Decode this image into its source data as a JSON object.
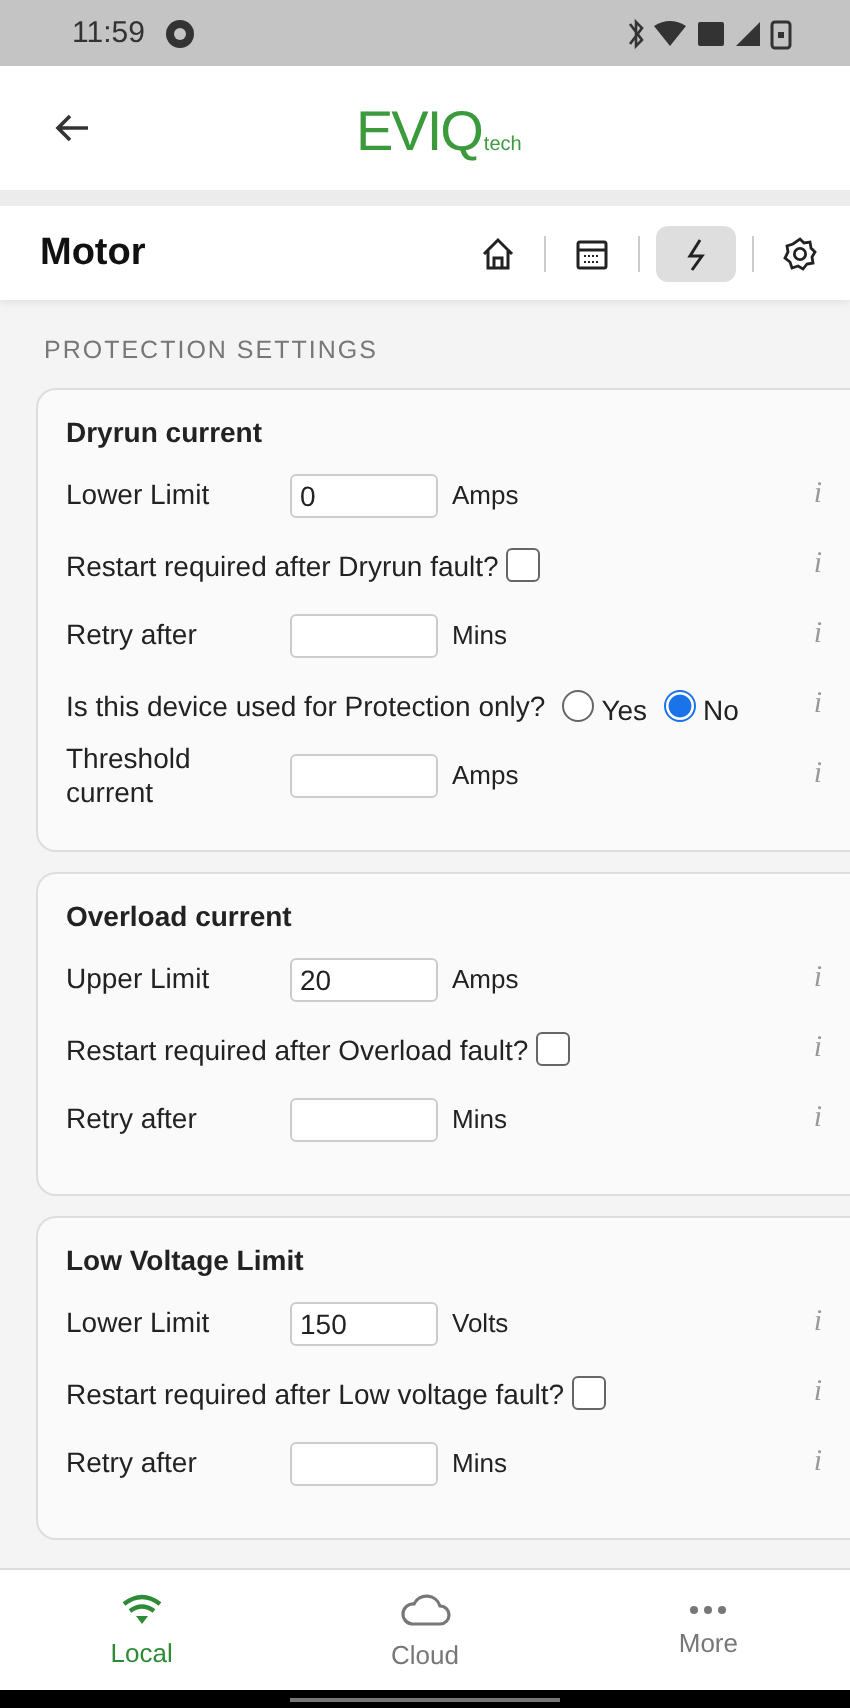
{
  "status_bar": {
    "time": "11:59"
  },
  "header": {
    "logo": "EVIQ",
    "logo_suffix": "tech"
  },
  "title_bar": {
    "title": "Motor",
    "toolbar": [
      {
        "kind": "home",
        "selected": false
      },
      {
        "kind": "calendar",
        "selected": false
      },
      {
        "kind": "bolt",
        "selected": true
      },
      {
        "kind": "gear",
        "selected": false
      }
    ]
  },
  "section_heading": "PROTECTION SETTINGS",
  "cards": [
    {
      "title": "Dryrun current",
      "rows": [
        {
          "kind": "field",
          "label": "Lower Limit",
          "value": "0",
          "unit": "Amps",
          "info": "i"
        },
        {
          "kind": "checkbox",
          "label": "Restart required after Dryrun fault?",
          "checked": false,
          "info": "i"
        },
        {
          "kind": "field",
          "label": "Retry after",
          "unit": "Mins",
          "info": "i"
        },
        {
          "kind": "radio",
          "label": "Is this device used for Protection only?",
          "options": [
            {
              "label": "Yes",
              "selected": false
            },
            {
              "label": "No",
              "selected": true
            }
          ],
          "info": "i"
        },
        {
          "kind": "field",
          "label": "Threshold current",
          "unit": "Amps",
          "info": "i"
        }
      ]
    },
    {
      "title": "Overload current",
      "rows": [
        {
          "kind": "field",
          "label": "Upper Limit",
          "value": "20",
          "unit": "Amps",
          "info": "i"
        },
        {
          "kind": "checkbox",
          "label": "Restart required after Overload fault?",
          "checked": false,
          "info": "i"
        },
        {
          "kind": "field",
          "label": "Retry after",
          "unit": "Mins",
          "info": "i"
        }
      ]
    },
    {
      "title": "Low Voltage Limit",
      "rows": [
        {
          "kind": "field",
          "label": "Lower Limit",
          "value": "150",
          "unit": "Volts",
          "info": "i"
        },
        {
          "kind": "checkbox",
          "label": "Restart required after Low voltage fault?",
          "checked": false,
          "info": "i"
        },
        {
          "kind": "field",
          "label": "Retry after",
          "unit": "Mins",
          "info": "i"
        }
      ]
    }
  ],
  "bottom_nav": [
    {
      "kind": "wifi",
      "label": "Local",
      "selected": true
    },
    {
      "kind": "cloud",
      "label": "Cloud",
      "selected": false
    },
    {
      "kind": "more",
      "label": "More",
      "selected": false
    }
  ]
}
